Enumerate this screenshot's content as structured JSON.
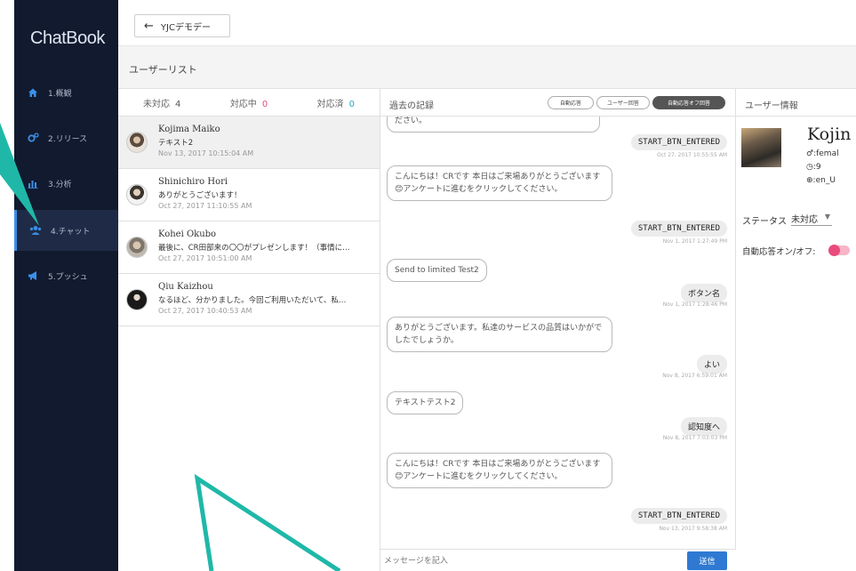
{
  "app": {
    "brand": "ChatBook"
  },
  "sidebar": {
    "items": [
      {
        "label": "1.概観",
        "icon": "home-icon"
      },
      {
        "label": "2.リリース",
        "icon": "gears-icon"
      },
      {
        "label": "3.分析",
        "icon": "bar-chart-icon"
      },
      {
        "label": "4.チャット",
        "icon": "users-icon",
        "active": true
      },
      {
        "label": "5.プッシュ",
        "icon": "megaphone-icon"
      }
    ]
  },
  "topbar": {
    "back_label": "YJCデモデー",
    "back_icon": "arrow-left-icon"
  },
  "page": {
    "title": "ユーザーリスト"
  },
  "user_list": {
    "tabs": [
      {
        "label": "未対応",
        "count": "4",
        "count_color": "#555555"
      },
      {
        "label": "対応中",
        "count": "0",
        "count_color": "#e94b7d"
      },
      {
        "label": "対応済",
        "count": "0",
        "count_color": "#21a9c6"
      }
    ],
    "users": [
      {
        "name": "Kojima Maiko",
        "message": "テキスト2",
        "time": "Nov 13, 2017 10:15:04 AM",
        "selected": true
      },
      {
        "name": "Shinichiro Hori",
        "message": "ありがとうございます！",
        "time": "Oct 27, 2017 11:10:55 AM"
      },
      {
        "name": "Kohei Okubo",
        "message": "最後に、CR田部来の〇〇がプレゼンします！（事情に…",
        "time": "Oct 27, 2017 10:51:00 AM"
      },
      {
        "name": "Qiu Kaizhou",
        "message": "なるほど、分かりました。今回ご利用いただいて、私…",
        "time": "Oct 27, 2017 10:40:53 AM"
      }
    ]
  },
  "chat": {
    "title": "過去の記録",
    "chips": [
      "自動応答",
      "ユーザー回答",
      "自動応答オフ回答"
    ],
    "messages": [
      {
        "side": "left",
        "text": "ださい。"
      },
      {
        "side": "right",
        "text": "START_BTN_ENTERED",
        "time": "Oct 27, 2017 10:55:55 AM"
      },
      {
        "side": "left",
        "text": "こんにちは！CRです 本日はご来場ありがとうございます😊アンケートに進むをクリックしてください。"
      },
      {
        "side": "right",
        "text": "START_BTN_ENTERED",
        "time": "Nov 1, 2017 1:27:49 PM"
      },
      {
        "side": "left",
        "text": "Send to limited Test2"
      },
      {
        "side": "right",
        "text": "ボタン名",
        "time": "Nov 1, 2017 1:28:46 PM"
      },
      {
        "side": "left",
        "text": "ありがとうございます。私達のサービスの品質はいかがでしたでしょうか。"
      },
      {
        "side": "right",
        "text": "よい",
        "time": "Nov 8, 2017 6:59:01 AM"
      },
      {
        "side": "left",
        "text": "テキストテスト2"
      },
      {
        "side": "right",
        "text": "認知度へ",
        "time": "Nov 8, 2017 7:03:03 PM"
      },
      {
        "side": "left",
        "text": "こんにちは！CRです 本日はご来場ありがとうございます😊アンケートに進むをクリックしてください。"
      },
      {
        "side": "right",
        "text": "START_BTN_ENTERED",
        "time": "Nov 13, 2017 9:58:38 AM"
      }
    ],
    "input_placeholder": "メッセージを記入",
    "send_label": "送信"
  },
  "user_info": {
    "title": "ユーザー情報",
    "name": "Kojin",
    "gender": "♂:femal",
    "age": "◷:9",
    "locale": "⊕:en_U",
    "status_label": "ステータス",
    "status_value": "未対応",
    "auto_label": "自動応答オン/オフ:",
    "auto_toggle_on": true
  },
  "colors": {
    "sidebar_bg": "#111a2e",
    "accent": "#3b8fe8",
    "send_button": "#2f79d3",
    "toggle": "#e94b7d",
    "annotation_arrow": "#1fb8a8"
  }
}
